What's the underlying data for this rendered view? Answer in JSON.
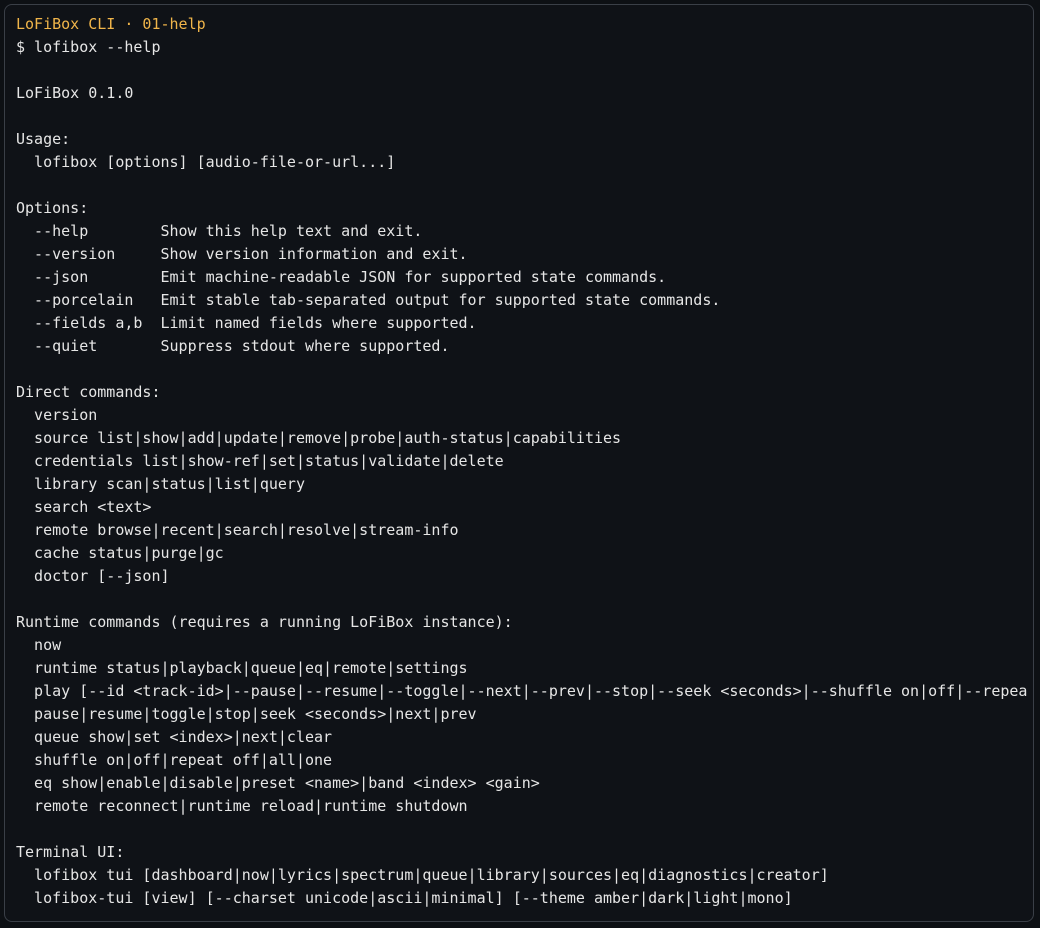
{
  "window": {
    "title": "LoFiBox CLI · 01-help"
  },
  "terminal": {
    "lines": [
      "$ lofibox --help",
      "",
      "LoFiBox 0.1.0",
      "",
      "Usage:",
      "  lofibox [options] [audio-file-or-url...]",
      "",
      "Options:",
      "  --help        Show this help text and exit.",
      "  --version     Show version information and exit.",
      "  --json        Emit machine-readable JSON for supported state commands.",
      "  --porcelain   Emit stable tab-separated output for supported state commands.",
      "  --fields a,b  Limit named fields where supported.",
      "  --quiet       Suppress stdout where supported.",
      "",
      "Direct commands:",
      "  version",
      "  source list|show|add|update|remove|probe|auth-status|capabilities",
      "  credentials list|show-ref|set|status|validate|delete",
      "  library scan|status|list|query",
      "  search <text>",
      "  remote browse|recent|search|resolve|stream-info",
      "  cache status|purge|gc",
      "  doctor [--json]",
      "",
      "Runtime commands (requires a running LoFiBox instance):",
      "  now",
      "  runtime status|playback|queue|eq|remote|settings",
      "  play [--id <track-id>|--pause|--resume|--toggle|--next|--prev|--stop|--seek <seconds>|--shuffle on|off|--repea",
      "  pause|resume|toggle|stop|seek <seconds>|next|prev",
      "  queue show|set <index>|next|clear",
      "  shuffle on|off|repeat off|all|one",
      "  eq show|enable|disable|preset <name>|band <index> <gain>",
      "  remote reconnect|runtime reload|runtime shutdown",
      "",
      "Terminal UI:",
      "  lofibox tui [dashboard|now|lyrics|spectrum|queue|library|sources|eq|diagnostics|creator]",
      "  lofibox-tui [view] [--charset unicode|ascii|minimal] [--theme amber|dark|light|mono]"
    ]
  },
  "colors": {
    "background": "#0f1217",
    "text": "#e6e6e6",
    "title": "#f0b54a",
    "border": "#3a3f47"
  }
}
